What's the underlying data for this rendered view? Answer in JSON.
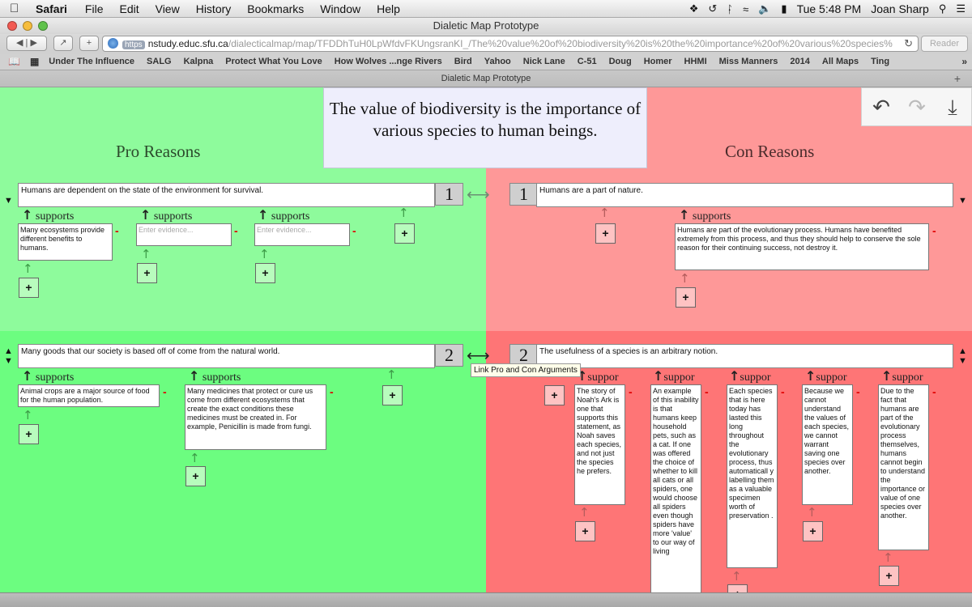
{
  "menubar": {
    "app": "Safari",
    "items": [
      "File",
      "Edit",
      "View",
      "History",
      "Bookmarks",
      "Window",
      "Help"
    ],
    "clock": "Tue 5:48 PM",
    "user": "Joan Sharp"
  },
  "window": {
    "title": "Dialetic Map Prototype",
    "url_scheme": "https",
    "url_host": "nstudy.educ.sfu.ca",
    "url_path": "/dialecticalmap/map/TFDDhTuH0LpWfdvFKUngsranKI_/The%20value%20of%20biodiversity%20is%20the%20importance%20of%20various%20species%",
    "reader": "Reader",
    "tab_title": "Dialetic Map Prototype"
  },
  "bookmarks": [
    "Under The Influence",
    "SALG",
    "Kalpna",
    "Protect What You Love",
    "How Wolves ...nge Rivers",
    "Bird",
    "Yahoo",
    "Nick Lane",
    "C-51",
    "Doug",
    "Homer",
    "HHMI",
    "Miss Manners",
    "2014",
    "All Maps",
    "Ting"
  ],
  "map": {
    "claim": "The value of biodiversity is the importance of various species to human beings.",
    "pro_heading": "Pro Reasons",
    "con_heading": "Con Reasons",
    "supports_label": "supports",
    "supports_short": "suppor",
    "placeholder": "Enter evidence...",
    "plus": "+",
    "minus": "-",
    "tooltip": "Link Pro and Con Arguments",
    "rows": [
      {
        "number": "1",
        "pro": "Humans are dependent on the state of the environment for survival.",
        "con": "Humans are a part of nature.",
        "pro_evidence": [
          "Many ecosystems provide different benefits to humans."
        ],
        "con_evidence": [
          "Humans are part of the evolutionary process. Humans have benefited extremely from this process, and thus they should help to conserve the sole reason for their continuing success, not destroy it."
        ]
      },
      {
        "number": "2",
        "pro": "Many goods that our society is based off of come from the natural world.",
        "con": "The usefulness of a species is an arbitrary notion.",
        "pro_evidence": [
          "Animal crops are a major source of food for the human population.",
          "Many medicines that protect or cure us come from different ecosystems that create the exact conditions these medicines must be created in. For example, Penicillin is made from fungi."
        ],
        "con_evidence": [
          "The story of Noah's Ark is one that supports this statement, as Noah saves each species, and not just the species he prefers.",
          "An example of this inability is that humans keep household pets, such as a cat. If one was offered the choice of whether to kill all cats or all spiders, one would choose all spiders even though spiders have more 'value' to our way of living",
          "Each species that is here today has lasted this long throughout the evolutionary process, thus automaticall y labelling them as a valuable specimen worth of preservation .",
          "Because we cannot understand the values of each species, we cannot warrant saving one species over another.",
          "Due to the fact that humans are part of the evolutionary process themselves, humans cannot begin to understand the importance or value of one species over another."
        ]
      }
    ]
  }
}
